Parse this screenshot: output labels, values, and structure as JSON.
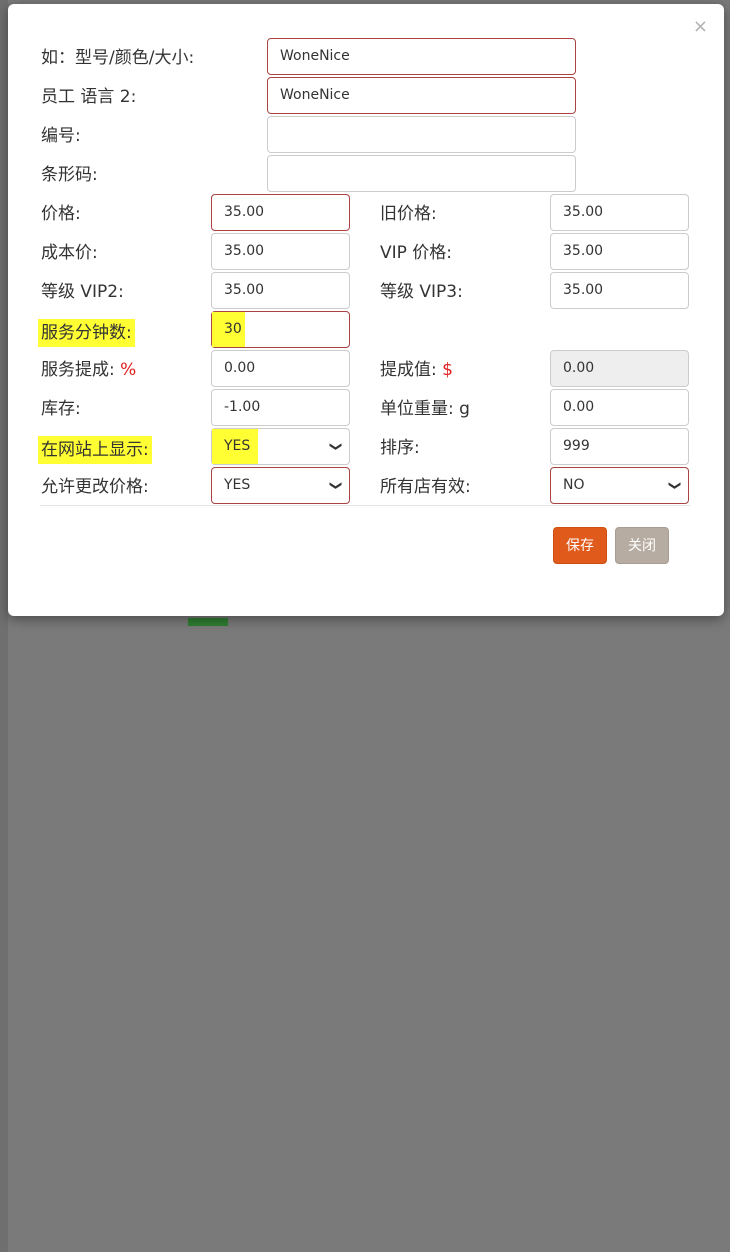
{
  "dialog": {
    "close_glyph": "×",
    "fields": {
      "model_label": "如：型号/颜色/大小:",
      "model_value": "WoneNice",
      "staff_lang2_label": "员工 语言 2:",
      "staff_lang2_value": "WoneNice",
      "code_label": "编号:",
      "code_value": "",
      "barcode_label": "条形码:",
      "barcode_value": "",
      "price_label": "价格:",
      "price_value": "35.00",
      "old_price_label": "旧价格:",
      "old_price_value": "35.00",
      "cost_label": "成本价:",
      "cost_value": "35.00",
      "vip_price_label": "VIP 价格:",
      "vip_price_value": "35.00",
      "vip2_label": "等级 VIP2:",
      "vip2_value": "35.00",
      "vip3_label": "等级 VIP3:",
      "vip3_value": "35.00",
      "service_minutes_label": "服务分钟数:",
      "service_minutes_value": "30",
      "service_commission_label": "服务提成: ",
      "service_commission_unit": "%",
      "service_commission_value": "0.00",
      "commission_value_label": "提成值: ",
      "commission_value_unit": "$",
      "commission_value_value": "0.00",
      "stock_label": "库存:",
      "stock_value": "-1.00",
      "unit_weight_label": "单位重量: g",
      "unit_weight_value": "0.00",
      "show_on_site_label": "在网站上显示:",
      "show_on_site_value": "YES",
      "sort_label": "排序:",
      "sort_value": "999",
      "allow_price_change_label": "允许更改价格:",
      "allow_price_change_value": "YES",
      "all_stores_label": "所有店有效:",
      "all_stores_value": "NO"
    },
    "save_label": "保存",
    "close_label": "关闭"
  },
  "colors": {
    "highlight": "#ffff33",
    "save_button": "#e05a1b",
    "close_button": "#b7aca1",
    "error_border": "#a94442",
    "unit_red": "#e02020"
  }
}
